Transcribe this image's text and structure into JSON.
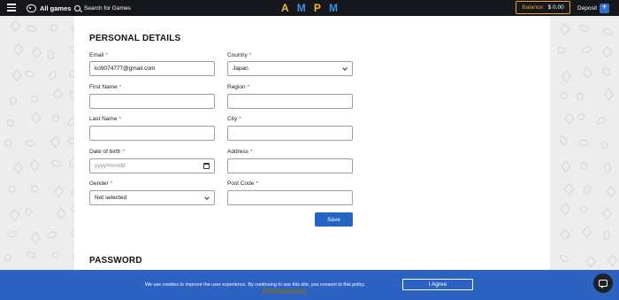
{
  "topbar": {
    "all_games_label": "All games",
    "search_label": "Search for Games",
    "logo_letters": [
      "A",
      "M",
      "P",
      "M"
    ],
    "balance_label": "Balance:",
    "balance_value": "$ 0.00",
    "deposit_label": "Deposit",
    "deposit_plus": "+"
  },
  "personal_details": {
    "title": "PERSONAL DETAILS",
    "email": {
      "label": "Email",
      "required": "*",
      "value": "ko9074777@gmail.com"
    },
    "country": {
      "label": "Country",
      "required": "*",
      "value": "Japan"
    },
    "first_name": {
      "label": "First Name",
      "required": "*",
      "value": ""
    },
    "region": {
      "label": "Region",
      "required": "*",
      "value": ""
    },
    "last_name": {
      "label": "Last Name",
      "required": "*",
      "value": ""
    },
    "city": {
      "label": "City",
      "required": "*",
      "value": ""
    },
    "date_of_birth": {
      "label": "Date of birth",
      "required": "*",
      "placeholder": "yyyy/mm/dd"
    },
    "address": {
      "label": "Address",
      "required": "*",
      "value": ""
    },
    "gender": {
      "label": "Gender",
      "required": "*",
      "value": "Not selected"
    },
    "post_code": {
      "label": "Post Code",
      "required": "*",
      "value": ""
    },
    "save_label": "Save"
  },
  "password": {
    "title": "PASSWORD"
  },
  "cookie_bar": {
    "text": "We use cookies to improve the user experience. By continuing to use this site, you consent to this policy.",
    "agree_label": "I Agree"
  },
  "colors": {
    "topbar_bg": "#15171c",
    "accent_orange": "#e8a32c",
    "accent_blue": "#2563c4",
    "cookie_bg": "#2c63c2",
    "required_red": "#d23c3c"
  },
  "icons": [
    "hamburger-menu-icon",
    "gamepad-icon",
    "search-icon",
    "plus-icon",
    "chevron-down-icon",
    "calendar-icon",
    "chat-icon"
  ]
}
